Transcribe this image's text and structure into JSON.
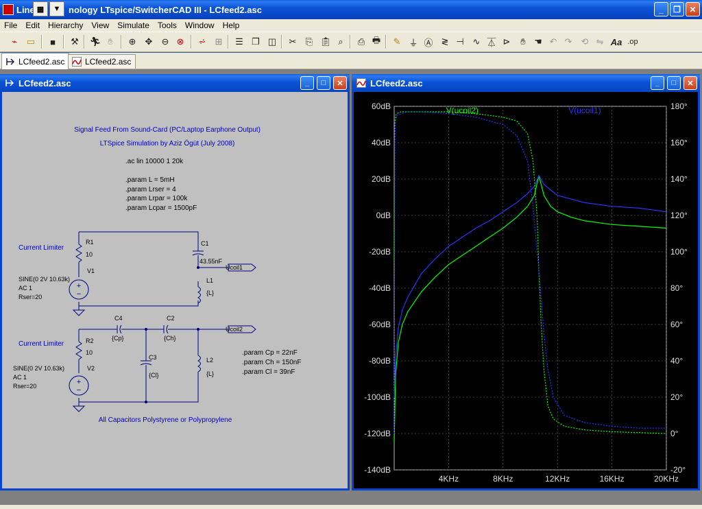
{
  "app": {
    "title": "Linear Technology LTspice/SwitcherCAD III - LCfeed2.asc",
    "title_visible_head": "Line",
    "title_visible_tail": "nology LTspice/SwitcherCAD III - LCfeed2.asc",
    "minimize": "_",
    "restore": "❐",
    "close": "✕"
  },
  "menu": [
    "File",
    "Edit",
    "Hierarchy",
    "View",
    "Simulate",
    "Tools",
    "Window",
    "Help"
  ],
  "toolbar": {
    "icons": [
      "new-schematic-icon",
      "open-icon",
      "save-icon",
      "control-panel-icon",
      "run-icon",
      "halt-icon",
      "zoom-in-icon",
      "zoom-pan-icon",
      "zoom-out-icon",
      "zoom-cancel-icon",
      "autorange-icon",
      "grid-icon",
      "tile-horizontal-icon",
      "cascade-icon",
      "tile-vertical-icon",
      "cut-icon",
      "copy-icon",
      "paste-icon",
      "find-icon",
      "print-setup-icon",
      "print-icon",
      "wire-icon",
      "ground-icon",
      "label-icon",
      "resistor-icon",
      "capacitor-icon",
      "inductor-icon",
      "diode-icon",
      "component-icon",
      "move-icon",
      "drag-icon",
      "undo-icon",
      "redo-icon",
      "rotate-icon",
      "mirror-icon",
      "text-icon",
      "spice-directive-icon"
    ],
    "text_label": "Aa",
    "op_label": ".op"
  },
  "tabs": [
    {
      "label": "LCfeed2.asc",
      "active": true
    },
    {
      "label": "LCfeed2.asc",
      "active": false
    }
  ],
  "schematic_window": {
    "title": "LCfeed2.asc",
    "header_line1": "Signal Feed From Sound-Card (PC/Laptop Earphone Output)",
    "header_line2": "LTSpice Simulation by Aziz Ögüt (July 2008)",
    "ac_directive": ".ac lin 10000 1 20k",
    "params1": [
      ".param L = 5mH",
      ".param Lrser = 4",
      ".param Lrpar = 100k",
      ".param Lcpar = 1500pF"
    ],
    "params2": [
      ".param Cp = 22nF",
      ".param Ch = 150nF",
      ".param Cl = 39nF"
    ],
    "current_limiter": "Current Limiter",
    "r1": "R1",
    "r1_val": "10",
    "c1": "C1",
    "c1_val": "43.55nF",
    "v1": "V1",
    "v1_spec": [
      "SINE(0 2V 10.63k)",
      "AC 1",
      "Rser=20"
    ],
    "l1": "L1",
    "l1_val": "{L}",
    "ucoil1": "Ucoil1",
    "c4": "C4",
    "c4_val": "{Cp}",
    "c2": "C2",
    "c2_val": "{Ch}",
    "ucoil2": "Ucoil2",
    "r2": "R2",
    "r2_val": "10",
    "c3": "C3",
    "c3_val": "{Cl}",
    "l2": "L2",
    "l2_val": "{L}",
    "v2": "V2",
    "v2_spec": [
      "SINE(0 2V 10.63k)",
      "AC 1",
      "Rser=20"
    ],
    "footer": "All Capacitors Polystyrene or Polypropylene"
  },
  "plot_window": {
    "title": "LCfeed2.asc"
  },
  "chart_data": {
    "type": "line",
    "title": "",
    "xlabel": "",
    "ylabel": "",
    "xlim": [
      0,
      20000
    ],
    "ylim": [
      -140,
      60
    ],
    "y2lim": [
      -20,
      180
    ],
    "x_ticks": [
      "4KHz",
      "8KHz",
      "12KHz",
      "16KHz",
      "20KHz"
    ],
    "x_tick_values": [
      4000,
      8000,
      12000,
      16000,
      20000
    ],
    "y_ticks": [
      "60dB",
      "40dB",
      "20dB",
      "0dB",
      "-20dB",
      "-40dB",
      "-60dB",
      "-80dB",
      "-100dB",
      "-120dB",
      "-140dB"
    ],
    "y_tick_values": [
      60,
      40,
      20,
      0,
      -20,
      -40,
      -60,
      -80,
      -100,
      -120,
      -140
    ],
    "y2_ticks": [
      "180°",
      "160°",
      "140°",
      "120°",
      "100°",
      "80°",
      "60°",
      "40°",
      "20°",
      "0°",
      "-20°"
    ],
    "y2_tick_values": [
      180,
      160,
      140,
      120,
      100,
      80,
      60,
      40,
      20,
      0,
      -20
    ],
    "grid": true,
    "legend": "top",
    "series": [
      {
        "name": "V(ucoil2)",
        "color": "#00ff00",
        "kind": "magnitude",
        "x": [
          1,
          100,
          300,
          600,
          1000,
          2000,
          3000,
          4000,
          5000,
          6000,
          7000,
          8000,
          9000,
          9800,
          10300,
          10630,
          11000,
          11500,
          12000,
          13000,
          14000,
          16000,
          18000,
          20000
        ],
        "y": [
          -125,
          -88,
          -70,
          -60,
          -53,
          -42,
          -34,
          -27,
          -22,
          -17,
          -12,
          -7,
          -1,
          5,
          11,
          22,
          11,
          5,
          2,
          -1,
          -3,
          -5,
          -6,
          -7
        ]
      },
      {
        "name": "V(ucoil1)",
        "color": "#3030ff",
        "kind": "magnitude",
        "x": [
          1,
          100,
          300,
          600,
          1000,
          2000,
          3000,
          4000,
          5000,
          6000,
          7000,
          8000,
          9000,
          9800,
          10300,
          10630,
          11000,
          11500,
          12000,
          13000,
          14000,
          16000,
          18000,
          20000
        ],
        "y": [
          -100,
          -78,
          -62,
          -52,
          -45,
          -32,
          -24,
          -17,
          -12,
          -7,
          -3,
          2,
          7,
          12,
          16,
          22,
          17,
          14,
          11,
          9,
          7,
          5,
          4,
          2
        ]
      },
      {
        "name": "V(ucoil2)",
        "color": "#00ff00",
        "kind": "phase",
        "x": [
          1,
          50,
          100,
          200,
          500,
          1000,
          2000,
          4000,
          6000,
          8000,
          9000,
          9800,
          10200,
          10500,
          10630,
          10800,
          11000,
          11300,
          11700,
          12500,
          14000,
          16000,
          18000,
          20000
        ],
        "y": [
          95,
          170,
          175,
          176,
          177,
          177,
          177,
          177,
          176,
          174,
          172,
          165,
          150,
          120,
          90,
          60,
          35,
          15,
          8,
          4,
          2,
          1,
          0.5,
          0
        ]
      },
      {
        "name": "V(ucoil1)",
        "color": "#3030ff",
        "kind": "phase",
        "x": [
          1,
          50,
          100,
          200,
          500,
          1000,
          2000,
          4000,
          6000,
          8000,
          9000,
          9800,
          10200,
          10500,
          10630,
          10800,
          11000,
          11300,
          11700,
          12500,
          14000,
          16000,
          18000,
          20000
        ],
        "y": [
          0,
          160,
          172,
          175,
          176,
          177,
          177,
          176,
          174,
          170,
          164,
          150,
          125,
          100,
          90,
          75,
          55,
          35,
          20,
          10,
          6,
          4,
          3,
          3
        ]
      }
    ]
  }
}
